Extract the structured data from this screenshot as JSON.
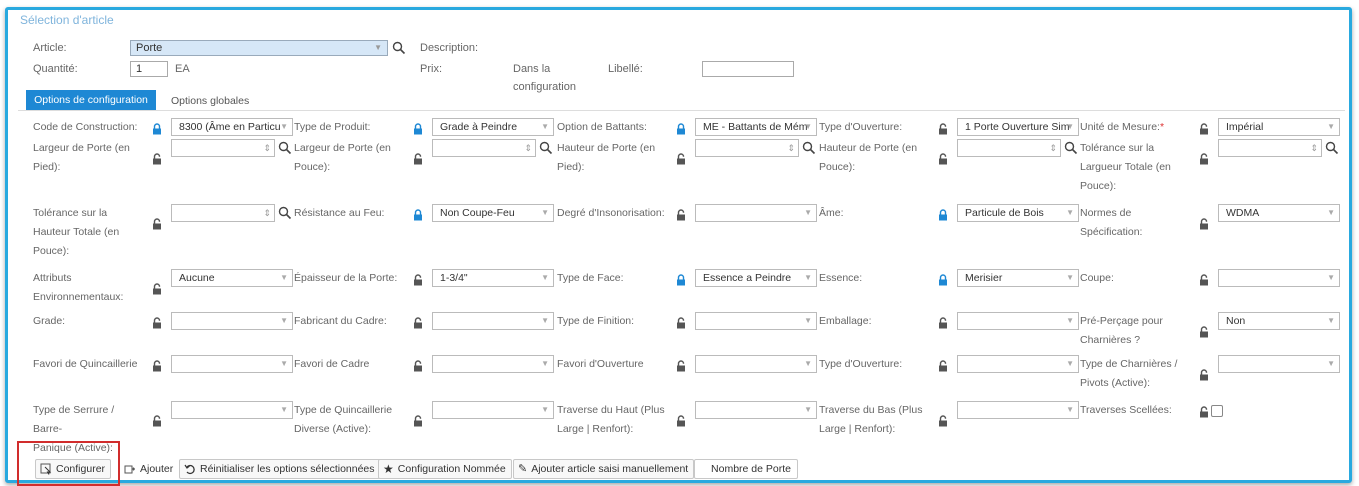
{
  "window": {
    "title": "Sélection d'article"
  },
  "header": {
    "article_label": "Article:",
    "article_value": "Porte",
    "quantity_label": "Quantité:",
    "quantity_value": "1",
    "quantity_unit": "EA",
    "description_label": "Description:",
    "price_label": "Prix:",
    "price_value_line1": "Dans la",
    "price_value_line2": "configuration",
    "libelle_label": "Libellé:",
    "libelle_value": ""
  },
  "tabs": [
    {
      "label": "Options de configuration",
      "active": true
    },
    {
      "label": "Options globales",
      "active": false
    }
  ],
  "fields": [
    {
      "label": [
        "Code de Construction:"
      ],
      "lock": "closed",
      "type": "select",
      "value": "8300 (Âme en Particu"
    },
    {
      "label": [
        "Type de Produit:"
      ],
      "lock": "closed",
      "type": "select",
      "value": "Grade à Peindre"
    },
    {
      "label": [
        "Option de Battants:"
      ],
      "lock": "closed",
      "type": "select",
      "value": "ME - Battants de Mém"
    },
    {
      "label": [
        "Type d'Ouverture:"
      ],
      "lock": "open",
      "type": "select",
      "value": "1 Porte Ouverture Sim"
    },
    {
      "label": [
        "Unité de Mesure:"
      ],
      "required": "*",
      "lock": "open",
      "type": "select",
      "value": "Impérial"
    },
    {
      "label": [
        "Largeur de Porte (en",
        "Pied):"
      ],
      "lock": "open",
      "type": "number",
      "value": ""
    },
    {
      "label": [
        "Largeur de Porte (en",
        "Pouce):"
      ],
      "lock": "open",
      "type": "number",
      "value": ""
    },
    {
      "label": [
        "Hauteur de Porte (en",
        "Pied):"
      ],
      "lock": "open",
      "type": "number",
      "value": ""
    },
    {
      "label": [
        "Hauteur de Porte (en",
        "Pouce):"
      ],
      "lock": "open",
      "type": "number",
      "value": ""
    },
    {
      "label": [
        "Tolérance sur la",
        "Largueur Totale (en",
        "Pouce):"
      ],
      "lock": "open",
      "type": "number",
      "value": ""
    },
    {
      "label": [
        "Tolérance sur la",
        "Hauteur Totale (en",
        "Pouce):"
      ],
      "lock": "open",
      "type": "number",
      "value": ""
    },
    {
      "label": [
        "Résistance au Feu:"
      ],
      "lock": "closed",
      "type": "select",
      "value": "Non Coupe-Feu"
    },
    {
      "label": [
        "Degré d'Insonorisation:"
      ],
      "lock": "open",
      "type": "select",
      "value": ""
    },
    {
      "label": [
        "Âme:"
      ],
      "lock": "closed",
      "type": "select",
      "value": "Particule de Bois"
    },
    {
      "label": [
        "Normes de",
        "Spécification:"
      ],
      "lock": "open",
      "type": "select",
      "value": "WDMA"
    },
    {
      "label": [
        "Attributs",
        "Environnementaux:"
      ],
      "lock": "open",
      "type": "select",
      "value": "Aucune"
    },
    {
      "label": [
        "Épaisseur de la Porte:"
      ],
      "lock": "open",
      "type": "select",
      "value": "1-3/4\""
    },
    {
      "label": [
        "Type de Face:"
      ],
      "lock": "closed",
      "type": "select",
      "value": "Essence a Peindre"
    },
    {
      "label": [
        "Essence:"
      ],
      "lock": "closed",
      "type": "select",
      "value": "Merisier"
    },
    {
      "label": [
        "Coupe:"
      ],
      "lock": "open",
      "type": "select",
      "value": ""
    },
    {
      "label": [
        "Grade:"
      ],
      "lock": "open",
      "type": "select",
      "value": ""
    },
    {
      "label": [
        "Fabricant du Cadre:"
      ],
      "lock": "open",
      "type": "select",
      "value": ""
    },
    {
      "label": [
        "Type de Finition:"
      ],
      "lock": "open",
      "type": "select",
      "value": ""
    },
    {
      "label": [
        "Emballage:"
      ],
      "lock": "open",
      "type": "select",
      "value": ""
    },
    {
      "label": [
        "Pré-Perçage pour",
        "Charnières ?"
      ],
      "lock": "open",
      "type": "select",
      "value": "Non"
    },
    {
      "label": [
        "Favori de Quincaillerie"
      ],
      "lock": "open",
      "type": "select",
      "value": ""
    },
    {
      "label": [
        "Favori de Cadre"
      ],
      "lock": "open",
      "type": "select",
      "value": ""
    },
    {
      "label": [
        "Favori d'Ouverture"
      ],
      "lock": "open",
      "type": "select",
      "value": ""
    },
    {
      "label": [
        "Type d'Ouverture:"
      ],
      "lock": "open",
      "type": "select",
      "value": ""
    },
    {
      "label": [
        "Type de Charnières /",
        "Pivots (Active):"
      ],
      "lock": "open",
      "type": "select",
      "value": ""
    },
    {
      "label": [
        "Type de Serrure / Barre-",
        "Panique (Active):"
      ],
      "lock": "open",
      "type": "select",
      "value": ""
    },
    {
      "label": [
        "Type de Quincaillerie",
        "Diverse (Active):"
      ],
      "lock": "open",
      "type": "select",
      "value": ""
    },
    {
      "label": [
        "Traverse du Haut (Plus",
        "Large | Renfort):"
      ],
      "lock": "open",
      "type": "select",
      "value": ""
    },
    {
      "label": [
        "Traverse du Bas (Plus",
        "Large | Renfort):"
      ],
      "lock": "open",
      "type": "select",
      "value": ""
    },
    {
      "label": [
        "Traverses Scellées:"
      ],
      "lock": "open",
      "type": "checkbox",
      "value": false
    }
  ],
  "toolbar": {
    "configurer": "Configurer",
    "ajouter": "Ajouter",
    "reinitialiser": "Réinitialiser les options sélectionnées",
    "config_nommee": "Configuration Nommée",
    "ajouter_manuel": "Ajouter article saisi manuellement",
    "nombre_porte": "Nombre de Porte"
  },
  "colors": {
    "accent": "#1e88d4",
    "lock_closed": "#1e88d4",
    "highlight": "#d12d2d"
  }
}
